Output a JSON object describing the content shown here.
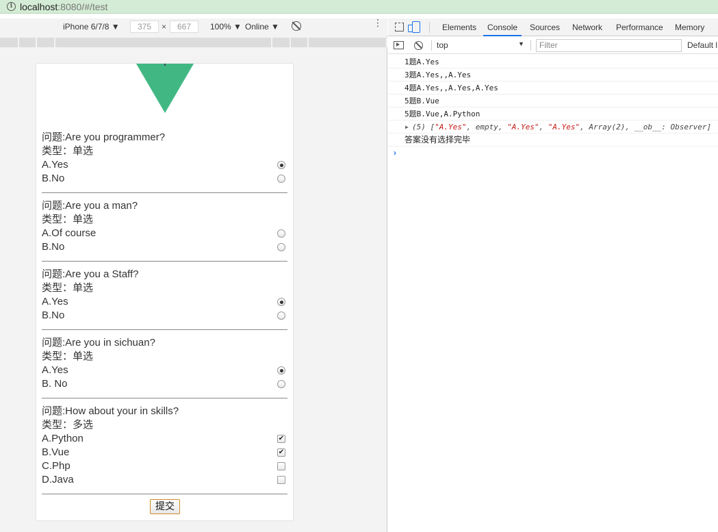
{
  "browser": {
    "url_host": "localhost",
    "url_rest": ":8080/#/test"
  },
  "device_toolbar": {
    "device": "iPhone 6/7/8 ▼",
    "width": "375",
    "times": "×",
    "height": "667",
    "zoom": "100% ▼",
    "network": "Online ▼"
  },
  "quiz": {
    "questions": [
      {
        "title": "问题:Are you programmer?",
        "type": "类型：单选",
        "kind": "radio",
        "options": [
          {
            "label": "A.Yes",
            "checked": true
          },
          {
            "label": "B.No",
            "checked": false
          }
        ]
      },
      {
        "title": "问题:Are you a man?",
        "type": "类型：单选",
        "kind": "radio",
        "options": [
          {
            "label": "A.Of course",
            "checked": false
          },
          {
            "label": "B.No",
            "checked": false
          }
        ]
      },
      {
        "title": "问题:Are you a Staff?",
        "type": "类型：单选",
        "kind": "radio",
        "options": [
          {
            "label": "A.Yes",
            "checked": true
          },
          {
            "label": "B.No",
            "checked": false
          }
        ]
      },
      {
        "title": "问题:Are you in sichuan?",
        "type": "类型：单选",
        "kind": "radio",
        "options": [
          {
            "label": "A.Yes",
            "checked": true
          },
          {
            "label": "B. No",
            "checked": false
          }
        ]
      },
      {
        "title": "问题:How about your in skills?",
        "type": "类型：多选",
        "kind": "checkbox",
        "options": [
          {
            "label": "A.Python",
            "checked": true
          },
          {
            "label": "B.Vue",
            "checked": true
          },
          {
            "label": "C.Php",
            "checked": false
          },
          {
            "label": "D.Java",
            "checked": false
          }
        ]
      }
    ],
    "submit_label": "提交"
  },
  "devtools": {
    "tabs": [
      "Elements",
      "Console",
      "Sources",
      "Network",
      "Performance",
      "Memory"
    ],
    "active_tab": "Console",
    "context": "top",
    "filter_placeholder": "Filter",
    "levels": "Default l",
    "accent_color": "#1a73e8"
  },
  "console": {
    "messages": [
      "1题A.Yes",
      "3题A.Yes,,A.Yes",
      "4题A.Yes,,A.Yes,A.Yes",
      "5题B.Vue",
      "5题B.Vue,A.Python"
    ],
    "array_log": {
      "prefix": "(5) [",
      "items": [
        "\"A.Yes\"",
        "empty",
        "\"A.Yes\"",
        "\"A.Yes\"",
        "Array(2)",
        "__ob__: Observer"
      ],
      "suffix": "]"
    },
    "final_message": "答案没有选择完毕",
    "prompt": "›"
  }
}
